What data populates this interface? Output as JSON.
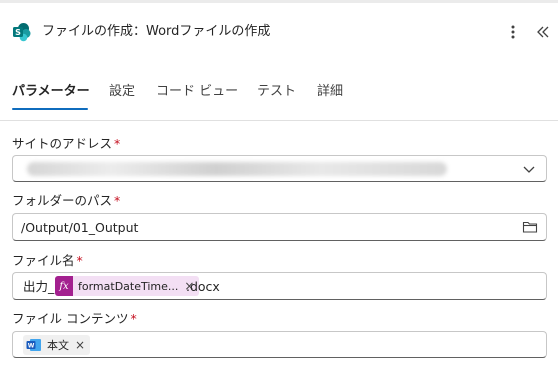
{
  "header": {
    "title": "ファイルの作成：Wordファイルの作成",
    "more_icon": "more-vertical-icon",
    "collapse_icon": "double-chevron-left-icon",
    "app_icon": "sharepoint-icon"
  },
  "tabs": [
    {
      "label": "パラメーター",
      "active": true
    },
    {
      "label": "設定"
    },
    {
      "label": "コード ビュー"
    },
    {
      "label": "テスト"
    },
    {
      "label": "詳細"
    }
  ],
  "fields": {
    "site_address": {
      "label": "サイトのアドレス",
      "required_mark": "*"
    },
    "folder_path": {
      "label": "フォルダーのパス",
      "required_mark": "*",
      "value": "/Output/01_Output"
    },
    "file_name": {
      "label": "ファイル名",
      "required_mark": "*",
      "prefix": "出力_",
      "token": {
        "badge": "fx",
        "text": "formatDateTime...",
        "remove": "×"
      },
      "suffix": ".docx"
    },
    "file_content": {
      "label": "ファイル コンテンツ",
      "required_mark": "*",
      "token": {
        "text": "本文",
        "remove": "×"
      }
    }
  },
  "colors": {
    "accent": "#0f6cbd",
    "required": "#c50f1f",
    "fx_badge": "#a3208f",
    "fx_token_bg": "#f3dff4",
    "word_blue": "#185abd",
    "sharepoint": "#036c70"
  }
}
